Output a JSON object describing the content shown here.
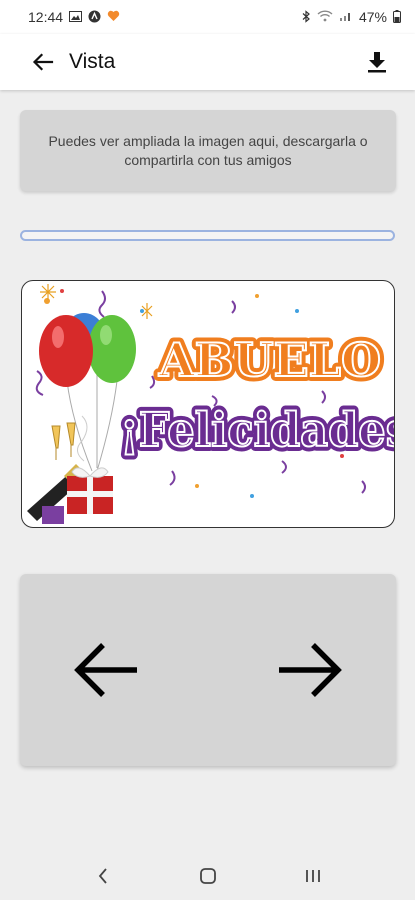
{
  "status_bar": {
    "time": "12:44",
    "battery": "47%",
    "left_icons": [
      "image-icon",
      "app-icon",
      "heart-icon"
    ],
    "right_icons": [
      "bluetooth-icon",
      "wifi-icon",
      "signal-icon",
      "battery-icon"
    ]
  },
  "app_bar": {
    "title": "Vista",
    "back_icon": "arrow-left-icon",
    "download_icon": "download-icon"
  },
  "info_card": {
    "text": "Puedes ver ampliada la imagen aqui, descargarla o compartirla con tus amigos"
  },
  "progress": {
    "value": 0
  },
  "greeting_image": {
    "line1": "ABUELO",
    "line2": "¡Felicidades"
  },
  "navigation": {
    "prev_icon": "arrow-left-icon",
    "next_icon": "arrow-right-icon"
  },
  "system_nav": {
    "buttons": [
      "back-icon",
      "home-icon",
      "recents-icon"
    ]
  },
  "colors": {
    "accent": "#9bb3e0",
    "orange": "#f07e1f",
    "purple": "#6a2c91"
  }
}
